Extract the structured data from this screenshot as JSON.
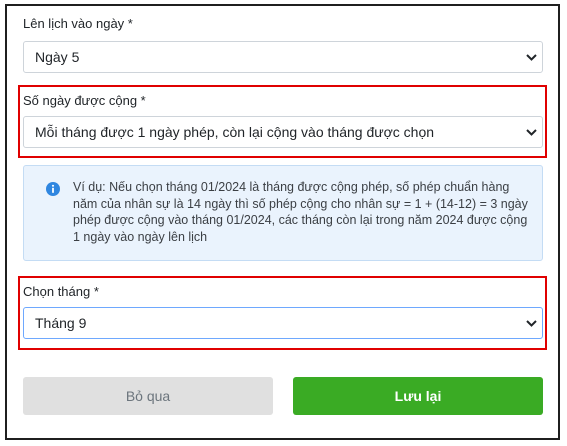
{
  "schedule": {
    "label": "Lên lịch vào ngày *",
    "selected": "Ngày 5"
  },
  "added_days": {
    "label": "Số ngày được cộng *",
    "selected": "Mỗi tháng được 1 ngày phép, còn lại cộng vào tháng được chọn"
  },
  "info": {
    "icon": "info-icon",
    "text": "Ví dụ: Nếu chọn tháng 01/2024 là tháng được cộng phép, số phép chuẩn hàng năm của nhân sự là 14 ngày thì số phép cộng cho nhân sự = 1 + (14-12) = 3 ngày phép được cộng vào tháng 01/2024, các tháng còn lại trong năm 2024 được cộng 1 ngày vào ngày lên lịch",
    "colors": {
      "background": "#eaf3fd",
      "icon": "#2f86e0"
    }
  },
  "month": {
    "label": "Chọn tháng *",
    "selected": "Tháng 9"
  },
  "buttons": {
    "skip_label": "Bỏ qua",
    "save_label": "Lưu lại"
  },
  "colors": {
    "highlight": "#e00000",
    "primary": "#3aab24",
    "secondary": "#e0e0e0",
    "focus_border": "#6ea8fe"
  }
}
